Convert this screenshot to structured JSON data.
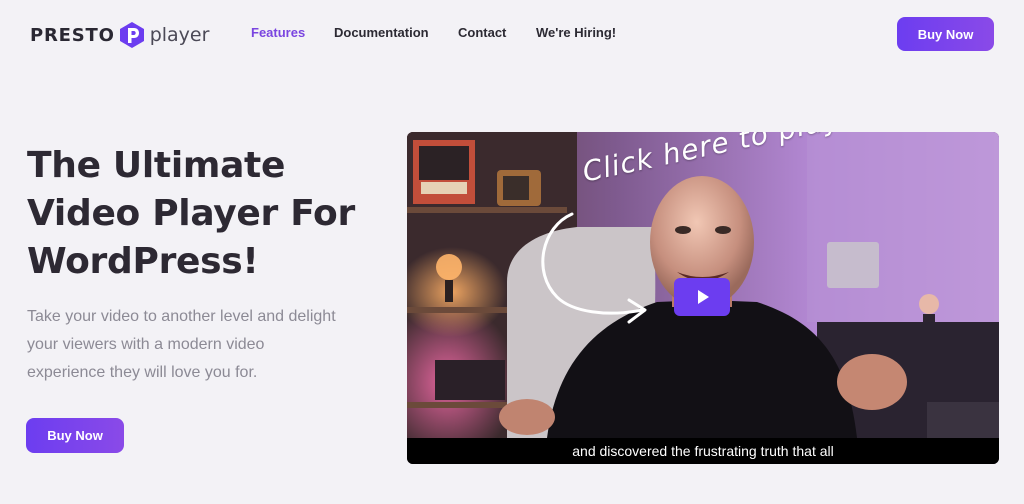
{
  "brand": {
    "name": "PRESTO",
    "suffix": "player",
    "accent": "#6c3df0"
  },
  "nav": {
    "items": [
      {
        "label": "Features",
        "active": true
      },
      {
        "label": "Documentation",
        "active": false
      },
      {
        "label": "Contact",
        "active": false
      },
      {
        "label": "We're Hiring!",
        "active": false
      }
    ]
  },
  "header": {
    "buy_label": "Buy Now"
  },
  "hero": {
    "title": "The Ultimate Video Player For WordPress!",
    "description": "Take your video to another level and delight your viewers with a modern video experience they will love you for.",
    "buy_label": "Buy Now"
  },
  "video": {
    "overlay_text": "Click here to play!",
    "caption": "and discovered the frustrating truth that all",
    "play_icon": "play-icon"
  }
}
